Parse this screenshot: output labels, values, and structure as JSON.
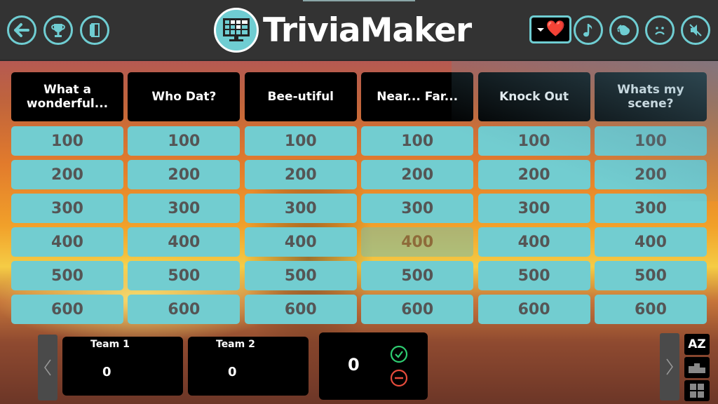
{
  "header": {
    "app_title": "TriviaMaker",
    "left_buttons": [
      {
        "name": "back-button",
        "icon": "arrow-left-icon"
      },
      {
        "name": "trophy-button",
        "icon": "trophy-icon"
      },
      {
        "name": "exit-button",
        "icon": "door-icon"
      }
    ],
    "emoji_select": {
      "selected": "❤️",
      "icon": "heart-emoji"
    },
    "right_buttons": [
      {
        "name": "music-button",
        "icon": "music-note-icon"
      },
      {
        "name": "applause-button",
        "icon": "clapping-hands-icon"
      },
      {
        "name": "sad-button",
        "icon": "sad-face-icon"
      },
      {
        "name": "mute-button",
        "icon": "speaker-muted-icon"
      }
    ],
    "colors": {
      "accent": "#6fcdd2",
      "background": "#333333"
    }
  },
  "board": {
    "categories": [
      {
        "title": "What a wonderful...",
        "values": [
          "100",
          "200",
          "300",
          "400",
          "500",
          "600"
        ],
        "used": []
      },
      {
        "title": "Who Dat?",
        "values": [
          "100",
          "200",
          "300",
          "400",
          "500",
          "600"
        ],
        "used": []
      },
      {
        "title": "Bee-utiful",
        "values": [
          "100",
          "200",
          "300",
          "400",
          "500",
          "600"
        ],
        "used": []
      },
      {
        "title": "Near... Far...",
        "values": [
          "100",
          "200",
          "300",
          "400",
          "500",
          "600"
        ],
        "used": [
          "400"
        ]
      },
      {
        "title": "Knock Out",
        "values": [
          "100",
          "200",
          "300",
          "400",
          "500",
          "600"
        ],
        "used": []
      },
      {
        "title": "Whats my scene?",
        "values": [
          "100",
          "200",
          "300",
          "400",
          "500",
          "600"
        ],
        "used": []
      }
    ],
    "colors": {
      "tile": "#72cdd0",
      "tile_text": "#555555",
      "header": "#000000"
    }
  },
  "scoreboard": {
    "teams": [
      {
        "name": "Team 1",
        "score": "0"
      },
      {
        "name": "Team 2",
        "score": "0"
      }
    ],
    "current_points": "0",
    "correct_icon": "check-circle-icon",
    "wrong_icon": "minus-circle-icon",
    "colors": {
      "correct": "#2ecc71",
      "wrong": "#e74c3c"
    }
  },
  "side_tools": {
    "sort_label": "AZ",
    "podium_icon": "podium-icon",
    "grid_icon": "grid-icon"
  }
}
